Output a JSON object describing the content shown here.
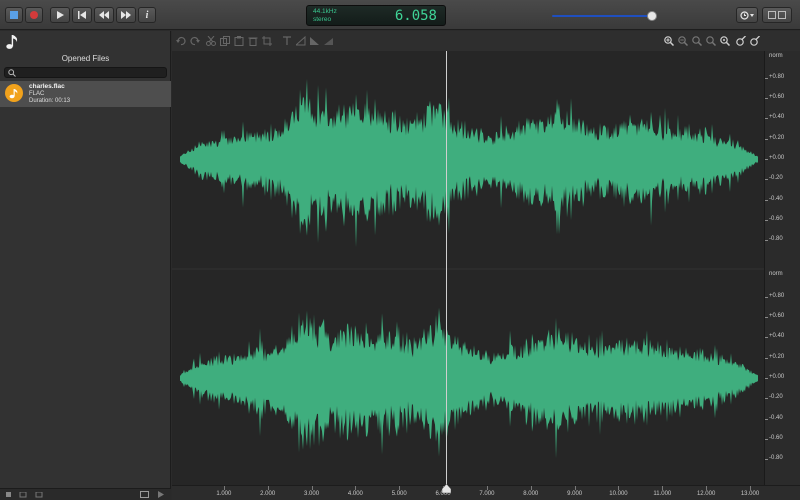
{
  "toolbar": {
    "lcd_format": "44.1kHz",
    "lcd_channels": "stereo",
    "lcd_time": "6.058",
    "volume_level": 0.96,
    "buttons": [
      "stop-icon",
      "record-icon",
      "play-icon",
      "skip-back-icon",
      "rewind-icon",
      "fast-forward-icon",
      "info-icon"
    ],
    "info_label": "i"
  },
  "sidebar": {
    "panel_title": "Opened Files",
    "search_placeholder": "",
    "files": [
      {
        "name": "charles.flac",
        "type": "FLAC",
        "duration": "Duration: 00:13",
        "icon": "music-note-icon",
        "icon_color": "#f1a21c"
      }
    ]
  },
  "editor": {
    "tools": [
      "undo-icon",
      "redo-icon",
      "cut-icon",
      "copy-icon",
      "paste-icon",
      "trash-icon",
      "crop-icon",
      "fade-in-icon",
      "fade-out-icon",
      "gain-icon",
      "zoom-in-icon",
      "zoom-out-icon",
      "zoom-fit-icon",
      "zoom-selection-icon",
      "zoom-full-icon",
      "marker-in-icon",
      "marker-out-icon"
    ],
    "channels": 2,
    "wave_color": "#3fae7e",
    "playhead_time": 6.058,
    "duration": 13.0
  },
  "scale": {
    "unit": "norm",
    "labels": [
      "+0.80",
      "+0.60",
      "+0.40",
      "+0.20",
      "+0.00",
      "-0.20",
      "-0.40",
      "-0.60",
      "-0.80"
    ]
  },
  "ruler": {
    "labels": [
      "1.000",
      "2.000",
      "3.000",
      "4.000",
      "5.000",
      "6.000",
      "7.000",
      "8.000",
      "9.000",
      "10.000",
      "11.000",
      "12.000",
      "13.000"
    ]
  }
}
